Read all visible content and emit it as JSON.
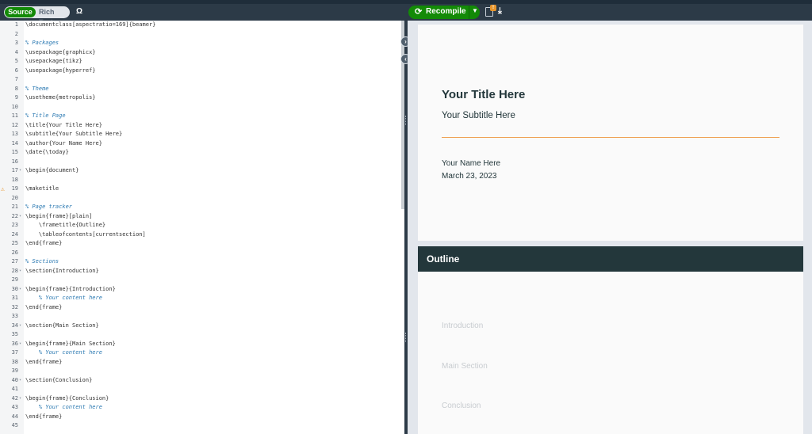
{
  "editor": {
    "mode_source": "Source",
    "mode_rich": "Rich Text",
    "symbol_button": "Ω",
    "lines": [
      {
        "n": "1",
        "text": "\\documentclass[aspectratio=169]{beamer}",
        "kind": "code"
      },
      {
        "n": "2",
        "text": "",
        "kind": "code"
      },
      {
        "n": "3",
        "text": "% Packages",
        "kind": "comment"
      },
      {
        "n": "4",
        "text": "\\usepackage{graphicx}",
        "kind": "code"
      },
      {
        "n": "5",
        "text": "\\usepackage{tikz}",
        "kind": "code"
      },
      {
        "n": "6",
        "text": "\\usepackage{hyperref}",
        "kind": "code"
      },
      {
        "n": "7",
        "text": "",
        "kind": "code"
      },
      {
        "n": "8",
        "text": "% Theme",
        "kind": "comment"
      },
      {
        "n": "9",
        "text": "\\usetheme{metropolis}",
        "kind": "code"
      },
      {
        "n": "10",
        "text": "",
        "kind": "code"
      },
      {
        "n": "11",
        "text": "% Title Page",
        "kind": "comment"
      },
      {
        "n": "12",
        "text": "\\title{Your Title Here}",
        "kind": "code"
      },
      {
        "n": "13",
        "text": "\\subtitle{Your Subtitle Here}",
        "kind": "code"
      },
      {
        "n": "14",
        "text": "\\author{Your Name Here}",
        "kind": "code"
      },
      {
        "n": "15",
        "text": "\\date{\\today}",
        "kind": "code"
      },
      {
        "n": "16",
        "text": "",
        "kind": "code"
      },
      {
        "n": "17",
        "text": "\\begin{document}",
        "kind": "code",
        "fold": true
      },
      {
        "n": "18",
        "text": "",
        "kind": "code"
      },
      {
        "n": "19",
        "text": "\\maketitle",
        "kind": "code",
        "warn": true
      },
      {
        "n": "20",
        "text": "",
        "kind": "code"
      },
      {
        "n": "21",
        "text": "% Page tracker",
        "kind": "comment"
      },
      {
        "n": "22",
        "text": "\\begin{frame}[plain]",
        "kind": "code",
        "fold": true
      },
      {
        "n": "23",
        "text": "    \\frametitle{Outline}",
        "kind": "code"
      },
      {
        "n": "24",
        "text": "    \\tableofcontents[currentsection]",
        "kind": "code"
      },
      {
        "n": "25",
        "text": "\\end{frame}",
        "kind": "code"
      },
      {
        "n": "26",
        "text": "",
        "kind": "code"
      },
      {
        "n": "27",
        "text": "% Sections",
        "kind": "comment"
      },
      {
        "n": "28",
        "text": "\\section{Introduction}",
        "kind": "code",
        "fold": true
      },
      {
        "n": "29",
        "text": "",
        "kind": "code"
      },
      {
        "n": "30",
        "text": "\\begin{frame}{Introduction}",
        "kind": "code",
        "fold": true
      },
      {
        "n": "31",
        "text": "    % Your content here",
        "kind": "comment"
      },
      {
        "n": "32",
        "text": "\\end{frame}",
        "kind": "code"
      },
      {
        "n": "33",
        "text": "",
        "kind": "code"
      },
      {
        "n": "34",
        "text": "\\section{Main Section}",
        "kind": "code",
        "fold": true
      },
      {
        "n": "35",
        "text": "",
        "kind": "code"
      },
      {
        "n": "36",
        "text": "\\begin{frame}{Main Section}",
        "kind": "code",
        "fold": true
      },
      {
        "n": "37",
        "text": "    % Your content here",
        "kind": "comment"
      },
      {
        "n": "38",
        "text": "\\end{frame}",
        "kind": "code"
      },
      {
        "n": "39",
        "text": "",
        "kind": "code"
      },
      {
        "n": "40",
        "text": "\\section{Conclusion}",
        "kind": "code",
        "fold": true
      },
      {
        "n": "41",
        "text": "",
        "kind": "code"
      },
      {
        "n": "42",
        "text": "\\begin{frame}{Conclusion}",
        "kind": "code",
        "fold": true
      },
      {
        "n": "43",
        "text": "    % Your content here",
        "kind": "comment"
      },
      {
        "n": "44",
        "text": "\\end{frame}",
        "kind": "code"
      },
      {
        "n": "45",
        "text": "",
        "kind": "code"
      }
    ]
  },
  "preview_toolbar": {
    "recompile_label": "Recompile",
    "recompile_icon": "refresh-icon",
    "dropdown_icon": "caret-down-icon",
    "logs_icon": "logs-icon",
    "logs_badge": "!",
    "download_icon": "download-icon"
  },
  "splitter": {
    "expand_icon": "arrow-right-icon",
    "collapse_icon": "arrow-left-icon"
  },
  "slides": {
    "title_slide": {
      "title": "Your Title Here",
      "subtitle": "Your Subtitle Here",
      "author": "Your Name Here",
      "date": "March 23, 2023"
    },
    "outline_slide": {
      "frame_title": "Outline",
      "toc": [
        "Introduction",
        "Main Section",
        "Conclusion"
      ]
    }
  },
  "colors": {
    "accent_green": "#138a07",
    "toolbar_bg": "#2c3a47",
    "frame_title_bg": "#23373b",
    "rule_orange": "#eb811b",
    "warning": "#e8962d"
  }
}
